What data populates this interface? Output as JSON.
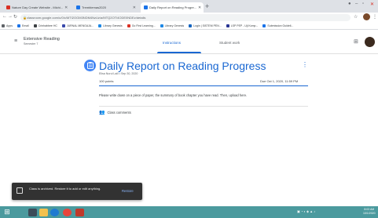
{
  "browser": {
    "tabs": [
      {
        "label": "Nature Day Create Website - Michi...",
        "active": false,
        "fav_color": "#d93025"
      },
      {
        "label": "Tremblemas2020",
        "active": false,
        "fav_color": "#1a73e8"
      },
      {
        "label": "Daily Report on Reading Progre...",
        "active": true,
        "fav_color": "#1a73e8"
      }
    ],
    "url": "classroom.google.com/u/0/c/MTI2OGM3NDM4NzUz/a/MTQ2OTI4ODE0NDEz/details",
    "bookmarks": [
      {
        "label": "Apps",
        "color": "#5f6368"
      },
      {
        "label": "Email",
        "color": "#1a73e8"
      },
      {
        "label": "Crinhabbee HC",
        "color": "#3c4043"
      },
      {
        "label": "JURNAL MENGAJA...",
        "color": "#3949ab"
      },
      {
        "label": "Library Genesis",
        "color": "#1e88e5"
      },
      {
        "label": "Go First Learning...",
        "color": "#d93025"
      },
      {
        "label": "Library Genesis",
        "color": "#1e88e5"
      },
      {
        "label": "Login | SISTEM PEN...",
        "color": "#1565c0"
      },
      {
        "label": "LSP PEP - Uji Komp...",
        "color": "#283593"
      },
      {
        "label": "Submission Guideli...",
        "color": "#1a73e8"
      }
    ]
  },
  "classroom": {
    "class_name": "Extensive Reading",
    "section": "Semester 7",
    "tabs": [
      "Instructions",
      "Student work"
    ],
    "active_tab": "Instructions"
  },
  "assignment": {
    "title": "Daily Report on Reading Progress",
    "author_date": "Elisa Nurul Laili • Sep 30, 2020",
    "points": "100 points",
    "due": "Due Oct 1, 2020, 11:59 PM",
    "instructions": "Please write down on a piece of paper, the summary of book chapter you have read. Then, upload here.",
    "class_comments": "Class comments"
  },
  "snackbar": {
    "message": "Class is archived. Restore it to add or edit anything.",
    "action": "Restore"
  },
  "taskbar": {
    "apps": [
      {
        "name": "task-view",
        "color": "#3c4b58"
      },
      {
        "name": "file-explorer",
        "color": "#f2c14e"
      },
      {
        "name": "edge",
        "color": "#1f7ad1"
      },
      {
        "name": "chrome",
        "color": "#e8453c"
      },
      {
        "name": "other",
        "color": "#c0392b"
      }
    ],
    "time": "8:03 AM",
    "date": "10/1/2020"
  },
  "colors": {
    "accent": "#1967d2",
    "taskbar": "#4b9a9e",
    "snackbar": "#323232"
  }
}
